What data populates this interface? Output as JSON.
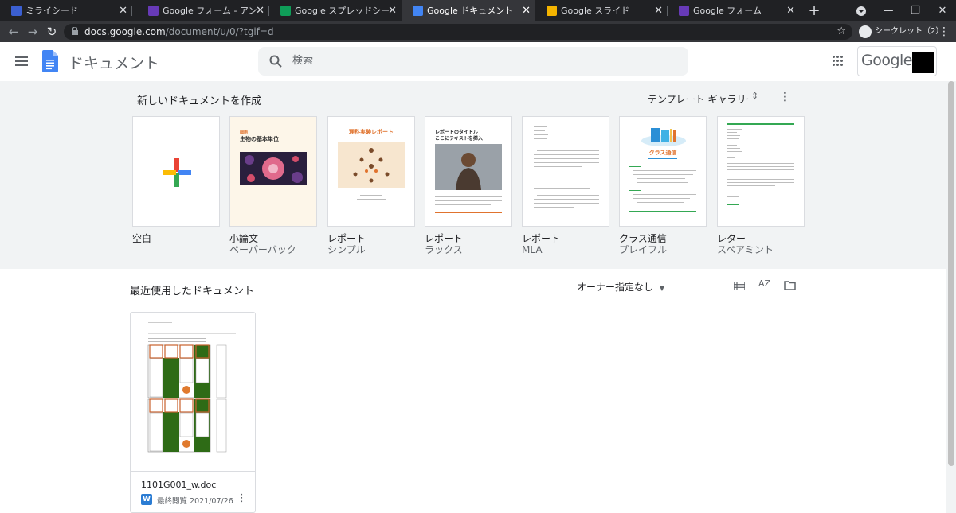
{
  "browser": {
    "tabs": [
      {
        "title": "ミライシード",
        "favicon_color": "#3b5fd1"
      },
      {
        "title": "Google フォーム - アンケートを作成",
        "favicon_color": "#673ab7"
      },
      {
        "title": "Google スプレッドシート",
        "favicon_color": "#0f9d58"
      },
      {
        "title": "Google ドキュメント",
        "favicon_color": "#4285f4"
      },
      {
        "title": "Google スライド",
        "favicon_color": "#f4b400"
      },
      {
        "title": "Google フォーム",
        "favicon_color": "#673ab7"
      }
    ],
    "active_tab_index": 3,
    "url_host": "docs.google.com",
    "url_path": "/document/u/0/?tgif=d",
    "incognito_label": "シークレット（2）"
  },
  "header": {
    "app_name": "ドキュメント",
    "search_placeholder": "検索",
    "account_logo_text": "Google"
  },
  "templates": {
    "section_title": "新しいドキュメントを作成",
    "gallery_label": "テンプレート ギャラリー",
    "items": [
      {
        "name": "空白",
        "sub": ""
      },
      {
        "name": "小論文",
        "sub": "ペーパーバック"
      },
      {
        "name": "レポート",
        "sub": "シンプル"
      },
      {
        "name": "レポート",
        "sub": "ラックス"
      },
      {
        "name": "レポート",
        "sub": "MLA"
      },
      {
        "name": "クラス通信",
        "sub": "プレイフル"
      },
      {
        "name": "レター",
        "sub": "スペアミント"
      }
    ],
    "thumb_text": {
      "essay_title_1": "細胞",
      "essay_title_2": "生物の基本単位",
      "simple_title": "理科実験レポート",
      "luxe_title_1": "レポートのタイトル",
      "luxe_title_2": "ここにテキストを挿入",
      "class_title": "クラス通信"
    }
  },
  "recent": {
    "section_title": "最近使用したドキュメント",
    "owner_filter": "オーナー指定なし",
    "sort_label": "AZ",
    "documents": [
      {
        "file_name": "1101G001_w.doc",
        "type_badge": "W",
        "last_opened": "最終閲覧 2021/07/26"
      }
    ]
  },
  "colors": {
    "accent_blue": "#4285f4",
    "chrome_dark": "#202124",
    "band_bg": "#f1f3f4"
  }
}
